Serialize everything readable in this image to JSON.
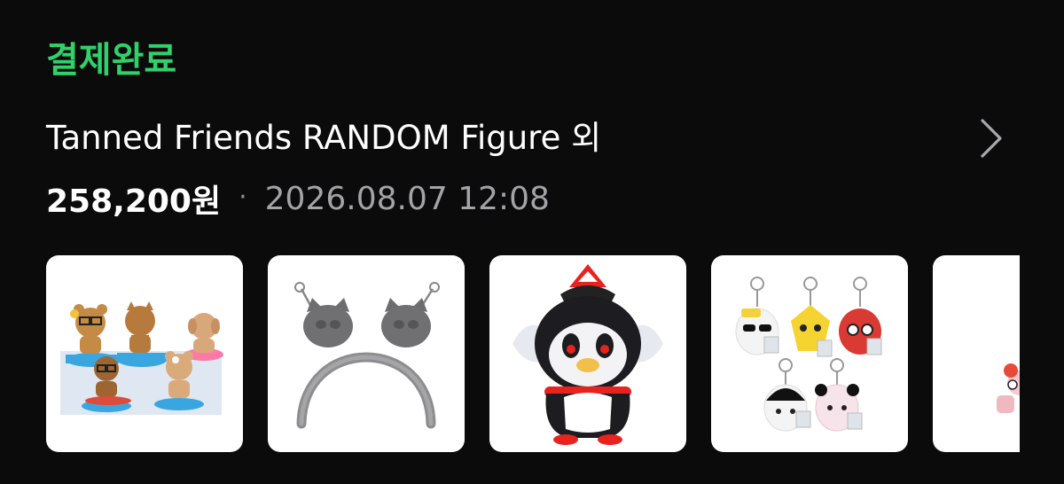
{
  "order": {
    "status": "결제완료",
    "title": "Tanned Friends RANDOM Figure 외",
    "amount": "258,200원",
    "separator": "·",
    "datetime": "2026.08.07 12:08"
  },
  "colors": {
    "status_green": "#2fd26a",
    "background": "#0b0b0c",
    "secondary_text": "#a3a3a8",
    "thumbnail_bg": "#ffffff"
  },
  "icons": {
    "detail": "chevron-right-icon"
  },
  "products": [
    {
      "image": "tanned-friends-figures"
    },
    {
      "image": "gray-cat-headband"
    },
    {
      "image": "penguin-plush"
    },
    {
      "image": "plush-keyrings-set"
    },
    {
      "image": "partial-product-image"
    }
  ]
}
